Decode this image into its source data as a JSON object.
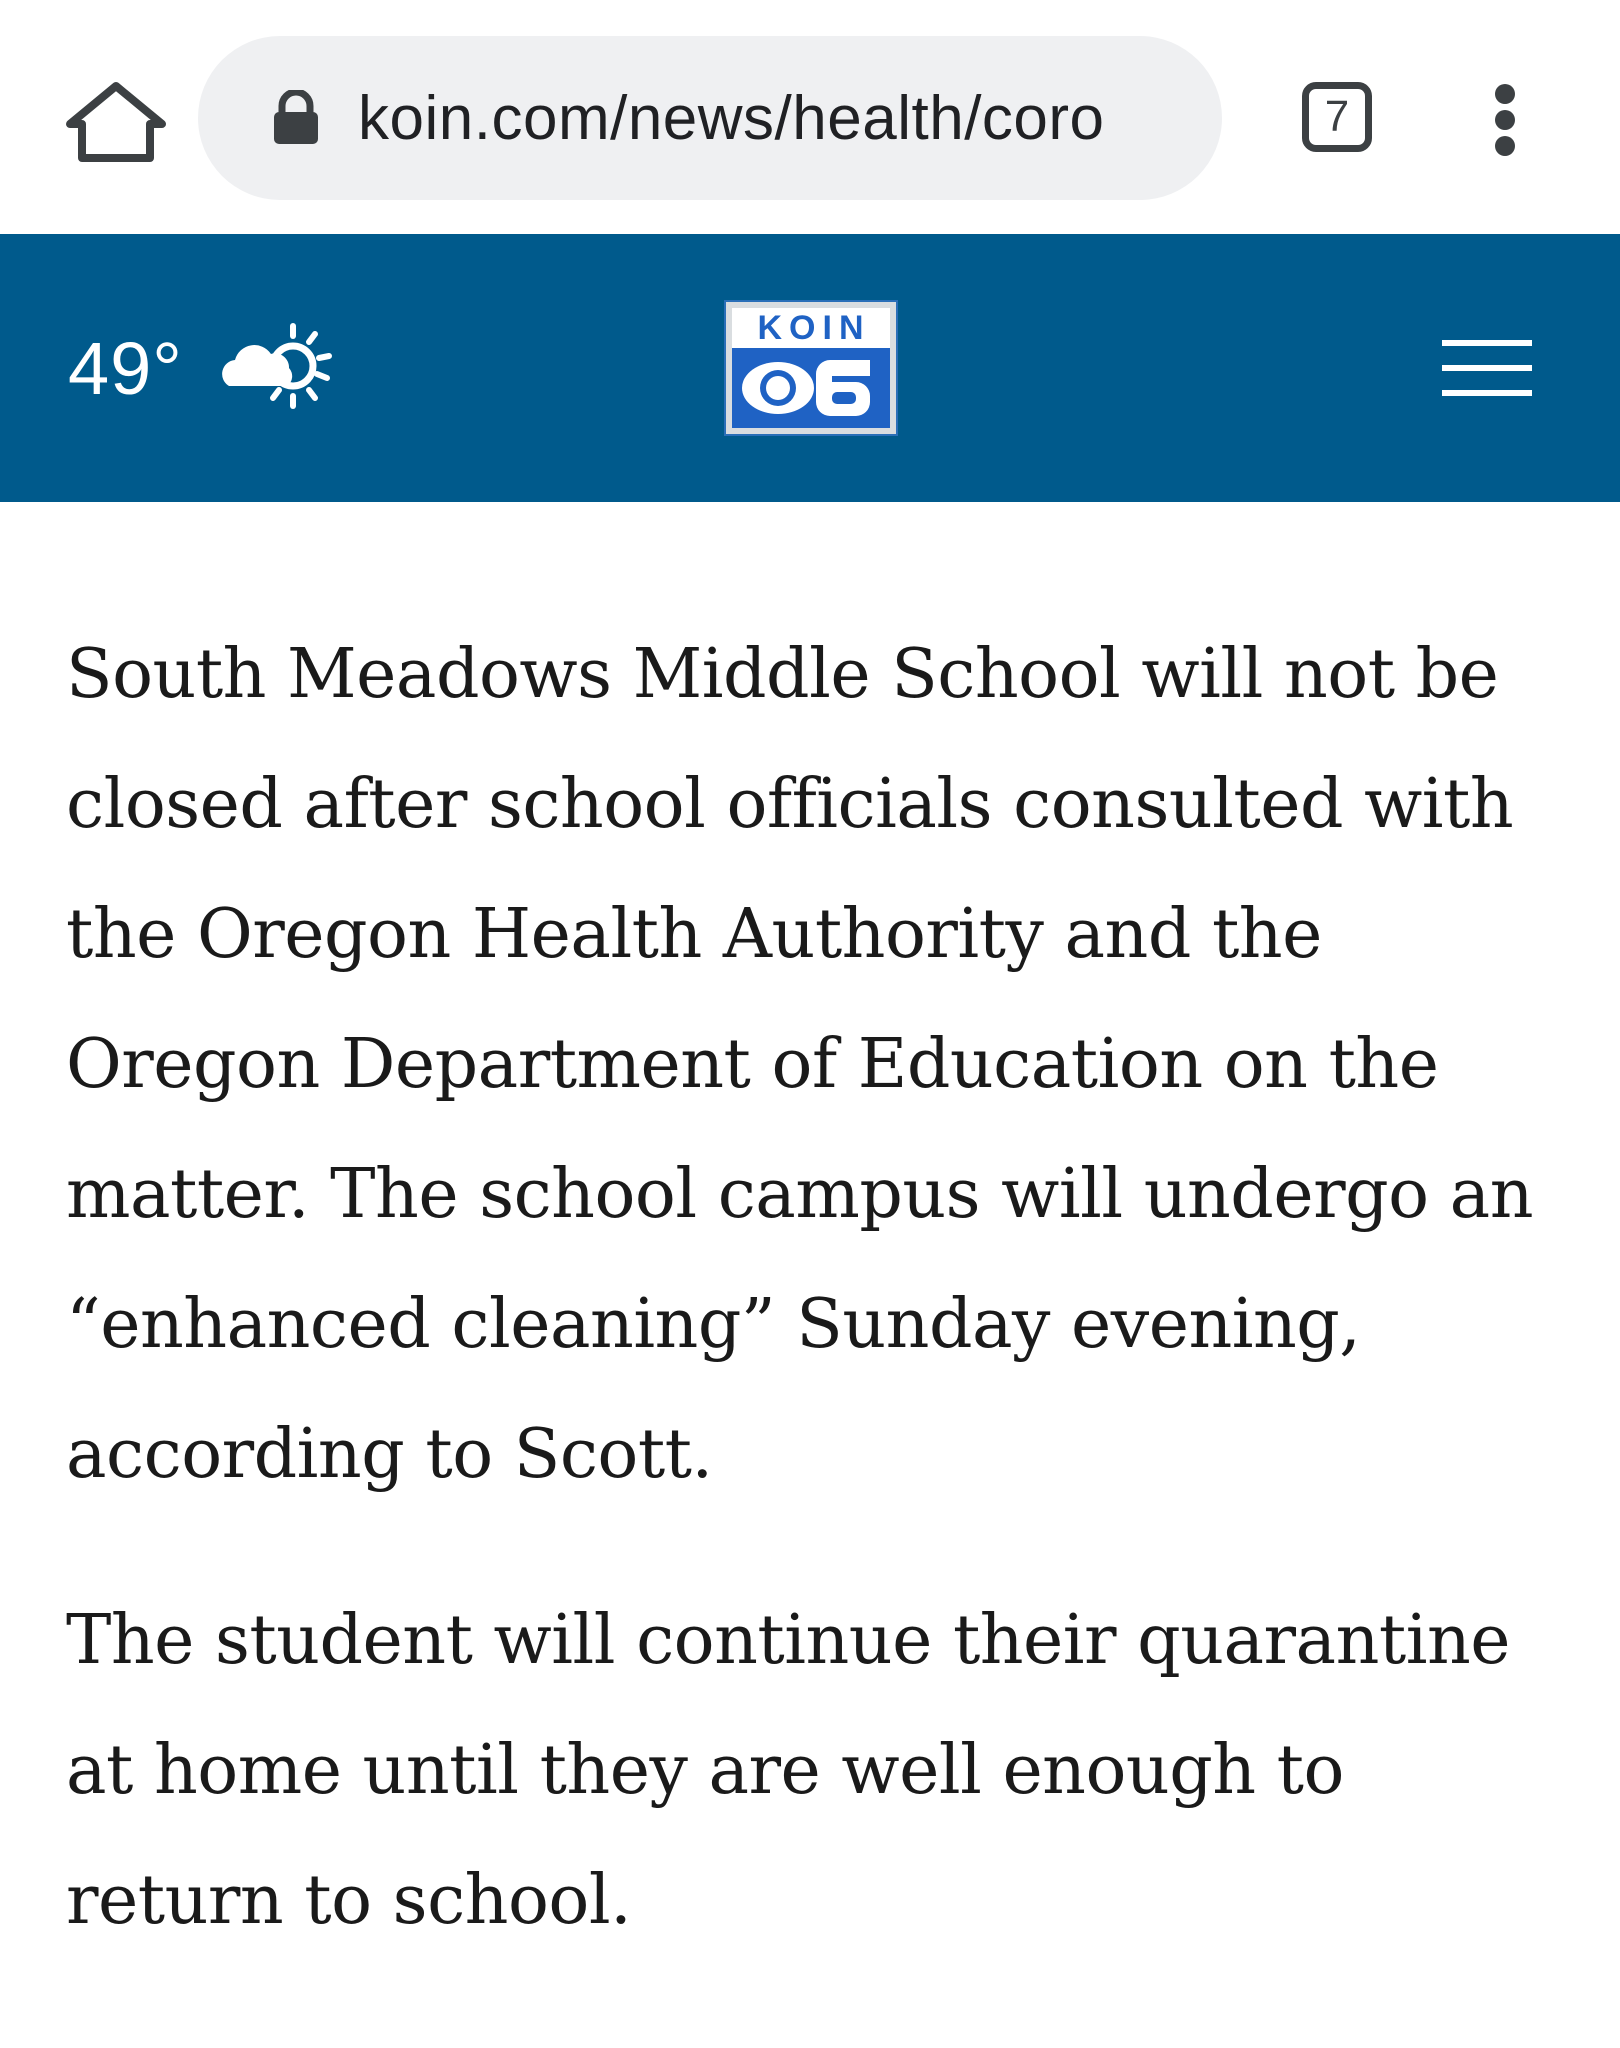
{
  "browser": {
    "url": "koin.com/news/health/coro",
    "tab_count": "7",
    "icons": {
      "home": "home-icon",
      "lock": "lock-icon",
      "menu": "more-vert-icon"
    }
  },
  "header": {
    "temperature": "49°",
    "weather_icon": "partly-sunny-icon",
    "logo": {
      "top_text": "KOIN",
      "bottom_text": "6",
      "brand_color": "#1f62c4"
    },
    "menu_icon": "hamburger-menu-icon",
    "background_color": "#005a8c"
  },
  "article": {
    "paragraphs": [
      "South Meadows Middle School will not be closed after school officials consulted with the Oregon Health Authority and the Oregon Department of Education on the matter. The school campus will undergo an “enhanced cleaning” Sunday evening, according to Scott.",
      "The student will continue their quarantine at home until they are well enough to return to school."
    ]
  }
}
